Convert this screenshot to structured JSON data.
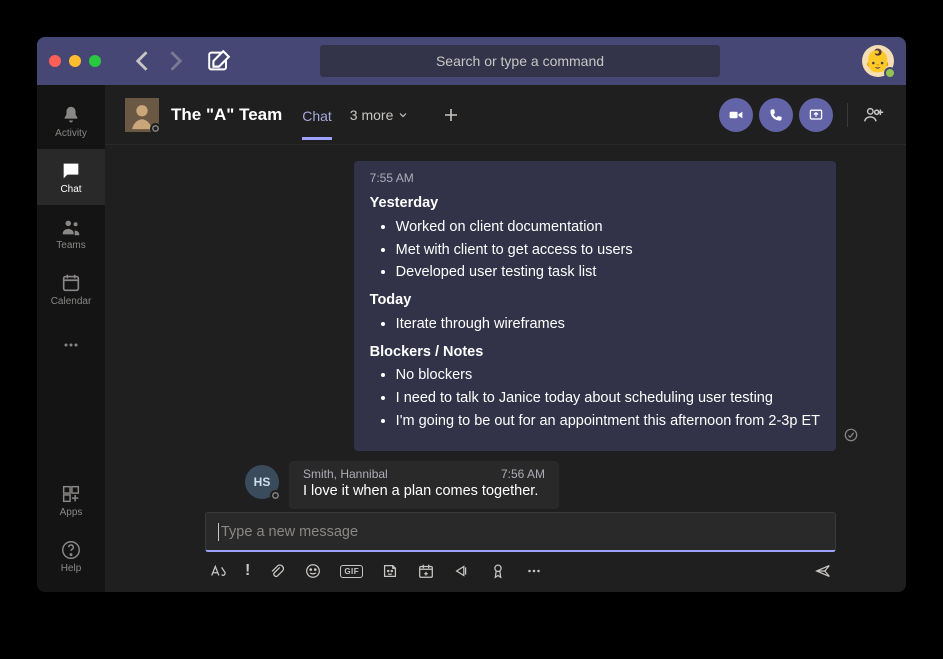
{
  "titlebar": {
    "search_placeholder": "Search or type a command"
  },
  "rail": {
    "activity": "Activity",
    "chat": "Chat",
    "teams": "Teams",
    "calendar": "Calendar",
    "apps": "Apps",
    "help": "Help"
  },
  "chat_header": {
    "title": "The \"A\" Team",
    "tab_chat": "Chat",
    "more_tabs": "3 more"
  },
  "messages": {
    "out1": {
      "time": "7:55 AM",
      "h1": "Yesterday",
      "y1": "Worked on client documentation",
      "y2": "Met with client to get access to users",
      "y3": "Developed user testing task list",
      "h2": "Today",
      "t1": "Iterate through wireframes",
      "h3": "Blockers / Notes",
      "b1": "No blockers",
      "b2": "I need to talk to Janice today about scheduling user testing",
      "b3": "I'm going to be out for an appointment this afternoon from 2-3p ET"
    },
    "in1": {
      "sender": "Smith, Hannibal",
      "initials": "HS",
      "time": "7:56 AM",
      "body": "I love it when a plan comes together."
    }
  },
  "compose": {
    "placeholder": "Type a new message",
    "gif_label": "GIF"
  }
}
